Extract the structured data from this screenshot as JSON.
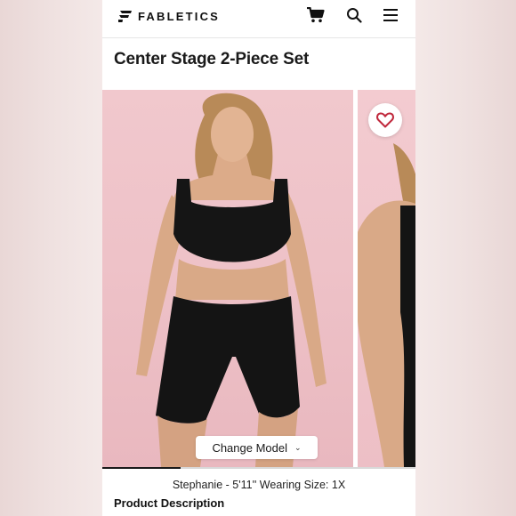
{
  "header": {
    "brand": "FABLETICS",
    "cart_icon": "cart-icon",
    "search_icon": "search-icon",
    "menu_icon": "hamburger-menu-icon"
  },
  "product": {
    "title": "Center Stage 2-Piece Set"
  },
  "gallery": {
    "change_model_label": "Change Model",
    "favorite_icon": "heart-icon",
    "progress": 0.25
  },
  "model_info": "Stephanie - 5'11'' Wearing Size: 1X",
  "section": {
    "product_description_heading": "Product Description"
  },
  "colors": {
    "heart": "#c0283c",
    "background_pink": "#eec2c8"
  }
}
